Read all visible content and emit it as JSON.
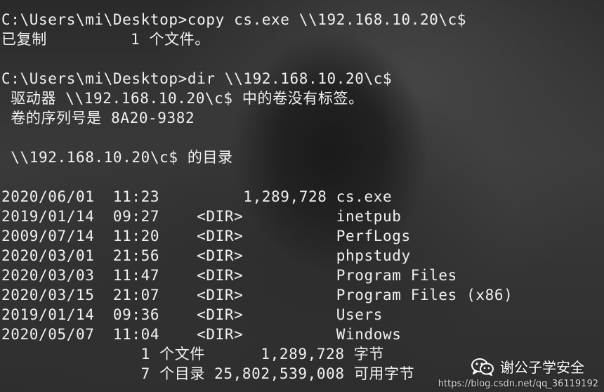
{
  "terminal": {
    "lines": [
      "C:\\Users\\mi\\Desktop>copy cs.exe \\\\192.168.10.20\\c$",
      "已复制         1 个文件。",
      "",
      "C:\\Users\\mi\\Desktop>dir \\\\192.168.10.20\\c$",
      " 驱动器 \\\\192.168.10.20\\c$ 中的卷没有标签。",
      " 卷的序列号是 8A20-9382",
      "",
      " \\\\192.168.10.20\\c$ 的目录",
      "",
      "2020/06/01  11:23         1,289,728 cs.exe",
      "2019/01/14  09:27    <DIR>          inetpub",
      "2009/07/14  11:20    <DIR>          PerfLogs",
      "2020/03/01  21:56    <DIR>          phpstudy",
      "2020/03/03  11:47    <DIR>          Program Files",
      "2020/03/15  21:07    <DIR>          Program Files (x86)",
      "2019/01/14  09:36    <DIR>          Users",
      "2020/05/07  11:04    <DIR>          Windows",
      "               1 个文件      1,289,728 字节",
      "               7 个目录 25,802,539,008 可用字节"
    ]
  },
  "watermark": {
    "icon": "wechat-icon",
    "text": "谢公子学安全",
    "url": "https://blog.csdn.net/qq_36119192"
  }
}
